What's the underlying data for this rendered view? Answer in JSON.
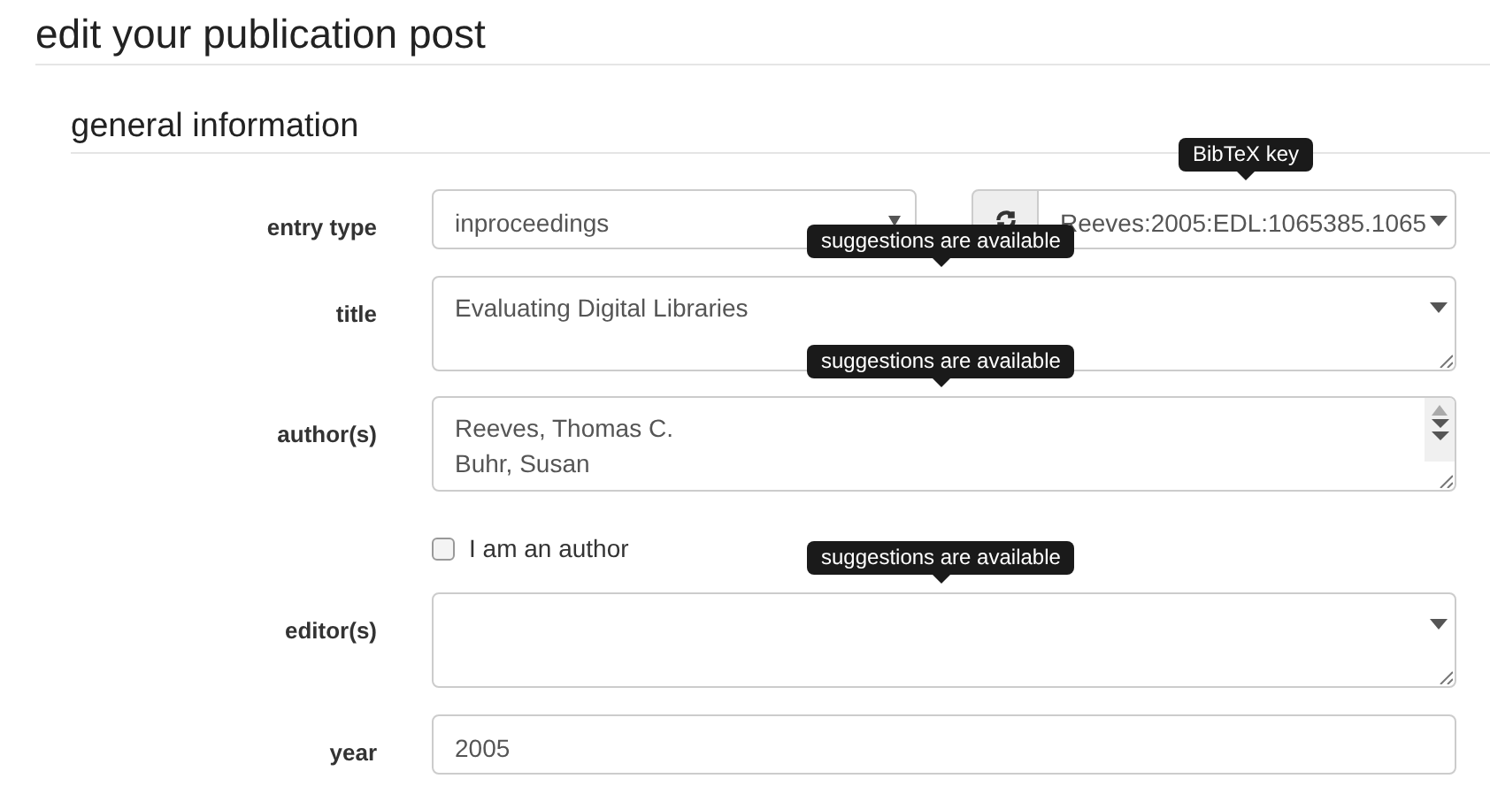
{
  "page_title": "edit your publication post",
  "section_title": "general information",
  "entry_type": {
    "label": "entry type",
    "value": "inproceedings",
    "key_tooltip": "BibTeX key",
    "key_value": "Reeves:2005:EDL:1065385.1065"
  },
  "fields": [
    {
      "kind": "textarea",
      "label": "title",
      "lines": [
        "Evaluating Digital Libraries"
      ],
      "tooltip": "suggestions are available",
      "scrollbar": false
    },
    {
      "kind": "textarea",
      "label": "author(s)",
      "lines": [
        "Reeves, Thomas C.",
        "Buhr, Susan"
      ],
      "tooltip": "suggestions are available",
      "scrollbar": true
    },
    {
      "kind": "checkbox",
      "label": "I am an author",
      "checked": false
    },
    {
      "kind": "textarea",
      "label": "editor(s)",
      "tooltip": "suggestions are available",
      "scrollbar": false
    },
    {
      "kind": "input",
      "label": "year",
      "value": "2005"
    }
  ]
}
